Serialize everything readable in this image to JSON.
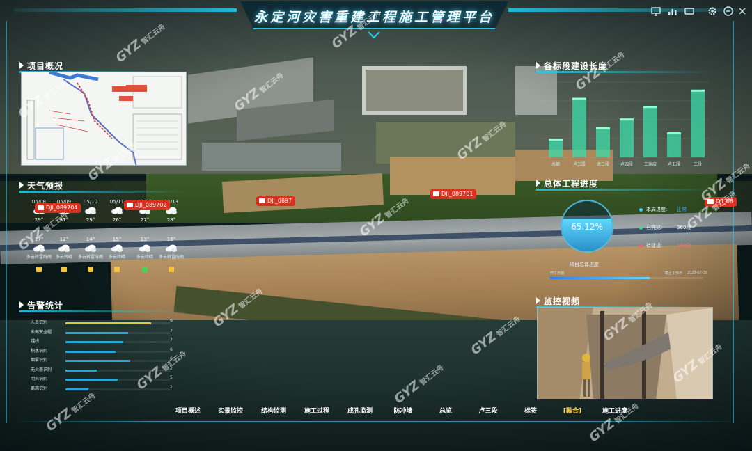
{
  "header": {
    "title": "永定河灾害重建工程施工管理平台",
    "icons": [
      "monitor-icon",
      "bar-icon",
      "settings-icon",
      "power-icon"
    ]
  },
  "panels": {
    "project_overview": {
      "title": "项目概况"
    },
    "weather": {
      "title": "天气预报",
      "days": [
        {
          "date": "05/08",
          "day_temp": "29°",
          "night_temp": "17°",
          "desc": "多云转雷阵雨",
          "badge_color": "#f4c542"
        },
        {
          "date": "05/09",
          "day_temp": "31°",
          "night_temp": "12°",
          "desc": "多云转晴",
          "badge_color": "#f4c542"
        },
        {
          "date": "05/10",
          "day_temp": "29°",
          "night_temp": "14°",
          "desc": "多云转雷阵雨",
          "badge_color": "#f4c542"
        },
        {
          "date": "05/11",
          "day_temp": "26°",
          "night_temp": "15°",
          "desc": "多云转晴",
          "badge_color": "#f4c542"
        },
        {
          "date": "05/12",
          "day_temp": "27°",
          "night_temp": "13°",
          "desc": "多云转晴",
          "badge_color": "#4ecf5a"
        },
        {
          "date": "05/13",
          "day_temp": "28°",
          "night_temp": "16°",
          "desc": "多云转雷阵雨",
          "badge_color": "#f4c542"
        }
      ]
    },
    "alarm": {
      "title": "告警统计",
      "rows": [
        {
          "label": "人员识别",
          "value": 9,
          "ratio": 0.82,
          "color": "#e3c93a"
        },
        {
          "label": "未佩安全帽",
          "value": 7,
          "ratio": 0.6,
          "color": "#2aa6d6"
        },
        {
          "label": "越线",
          "value": 7,
          "ratio": 0.55,
          "color": "#2aa6d6"
        },
        {
          "label": "积水识别",
          "value": 6,
          "ratio": 0.48,
          "color": "#2aa6d6"
        },
        {
          "label": "烟雾识别",
          "value": 6,
          "ratio": 0.62,
          "color": "#2aa6d6"
        },
        {
          "label": "无火器识别",
          "value": 2,
          "ratio": 0.3,
          "color": "#2aa6d6"
        },
        {
          "label": "明火识别",
          "value": 5,
          "ratio": 0.5,
          "color": "#2aa6d6"
        },
        {
          "label": "离岗识别",
          "value": 2,
          "ratio": 0.22,
          "color": "#2aa6d6"
        }
      ]
    },
    "segment_length": {
      "title": "各标段建设长度",
      "categories": [
        "总部",
        "卢三段",
        "北三段",
        "卢四段",
        "三家店",
        "卢五段",
        "三段"
      ],
      "values": [
        30,
        95,
        48,
        62,
        82,
        40,
        108
      ]
    },
    "overall_progress": {
      "title": "总体工程进度",
      "percent_text": "65.12%",
      "percent": 65.12,
      "items": [
        {
          "label": "本周进度:",
          "value": "正常",
          "dot": "#3fd0ff",
          "value_color": "#3fa9ff"
        },
        {
          "label": "已完成:",
          "value": "360段",
          "dot": "#3fe28a",
          "value_color": "#ffffff"
        },
        {
          "label": "待建设:",
          "value": "168段",
          "dot": "#ff5f6d",
          "value_color": "#ff6f7c"
        }
      ],
      "bar_label": "项目总体进度",
      "bar_left": "开工日期",
      "bar_right": "截止工作日",
      "bar_right_date": "2025-07-30"
    },
    "monitoring": {
      "title": "监控视频"
    }
  },
  "drones": [
    {
      "label": "DJI_089704"
    },
    {
      "label": "DJI_089702"
    },
    {
      "label": "DJI_0897"
    },
    {
      "label": "DJI_089701"
    },
    {
      "label": "DJI_08"
    }
  ],
  "nav": {
    "items": [
      {
        "label": "项目概述",
        "active": false
      },
      {
        "label": "实景监控",
        "active": false
      },
      {
        "label": "结构监测",
        "active": false
      },
      {
        "label": "施工过程",
        "active": false
      },
      {
        "label": "成孔监测",
        "active": false
      },
      {
        "label": "防冲墙",
        "active": false
      },
      {
        "label": "总览",
        "active": false
      },
      {
        "label": "卢三段",
        "active": false
      },
      {
        "label": "标签",
        "active": false
      },
      {
        "label": "[融合]",
        "active": true
      },
      {
        "label": "施工进度",
        "active": false
      }
    ]
  },
  "watermark": {
    "brand": "GYZ",
    "text": "智汇云舟"
  },
  "colors": {
    "accent": "#1fb7d6",
    "alert": "#d8321f",
    "water": "#5fd8ff"
  }
}
